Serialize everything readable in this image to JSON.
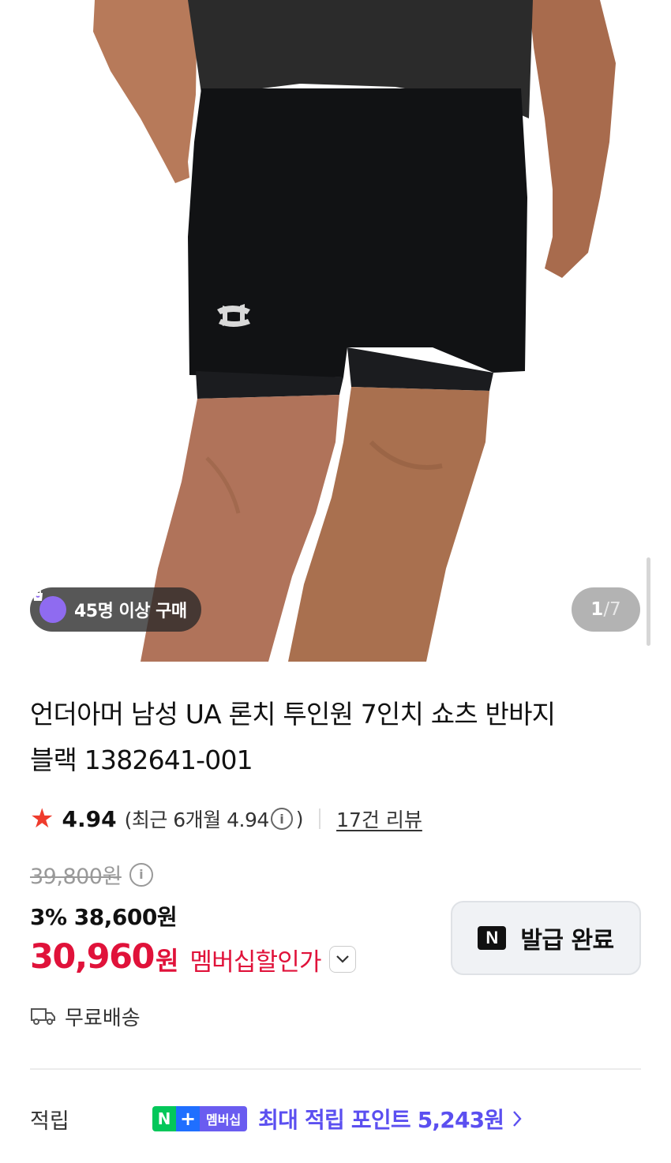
{
  "gallery": {
    "buyers_badge": "45명 이상 구매",
    "page_current": "1",
    "page_total": "/7"
  },
  "product": {
    "title_line1": "언더아머 남성 UA 론치 투인원 7인치 쇼츠 반바지",
    "title_line2": "블랙 1382641-001"
  },
  "rating": {
    "score": "4.94",
    "recent_prefix": "(최근 6개월 4.94",
    "recent_suffix": ")",
    "reviews": "17건 리뷰"
  },
  "price": {
    "original": "39,800원",
    "sale": "3% 38,600원",
    "member_price": "30,960",
    "member_unit": "원",
    "member_label": "멤버십할인가"
  },
  "coupon": {
    "icon_letter": "N",
    "label": "발급 완료"
  },
  "shipping": {
    "label": "무료배송"
  },
  "points": {
    "label": "적립",
    "badge_n": "N",
    "badge_plus": "+",
    "badge_text": "멤버십",
    "text": "최대 적립 포인트 5,243원"
  },
  "colors": {
    "member_price": "#e0123a",
    "points": "#5b4ff0",
    "star": "#ef3b2c",
    "naver_green": "#03c75a"
  }
}
